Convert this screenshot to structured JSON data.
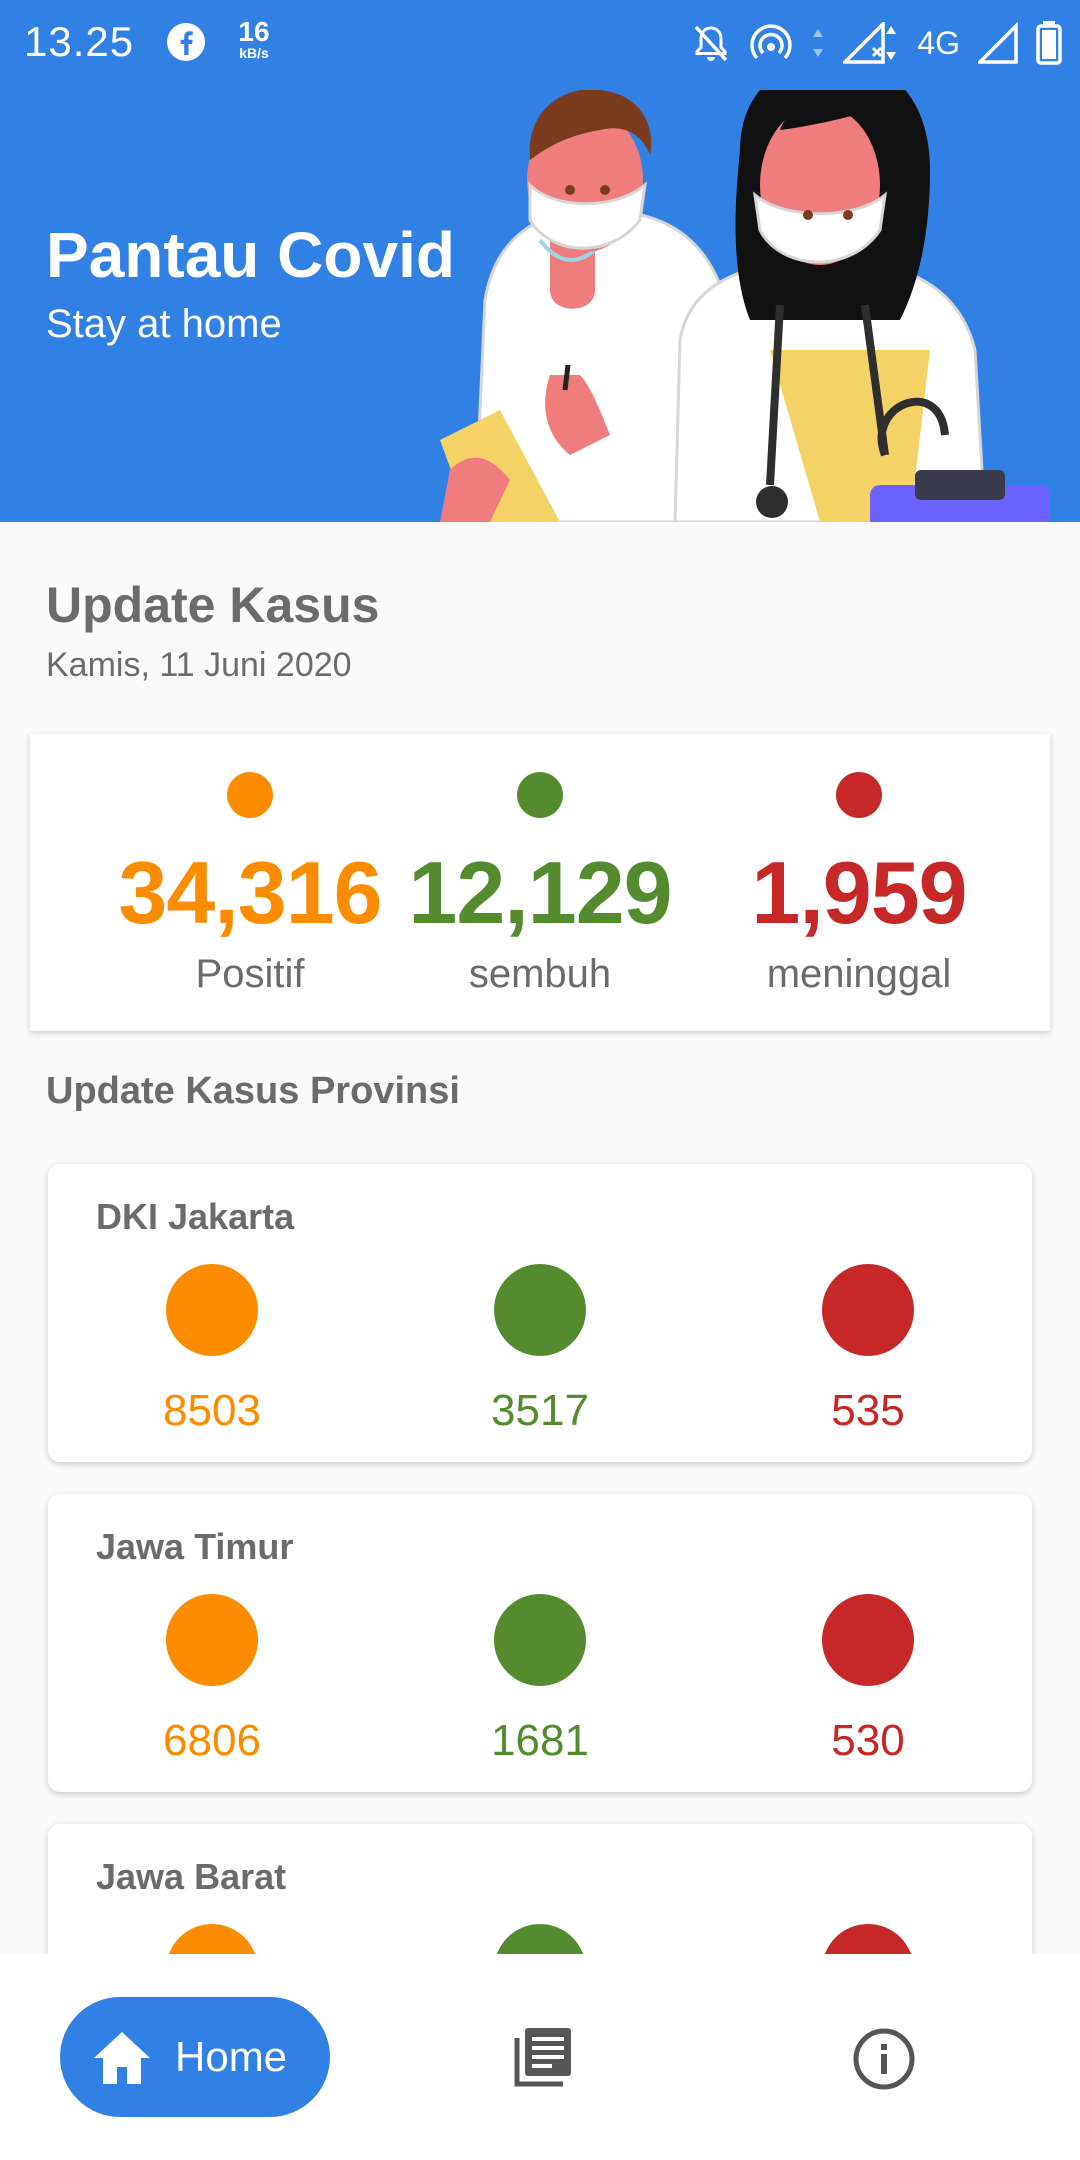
{
  "status_bar": {
    "time": "13.25",
    "speed_value": "16",
    "speed_unit": "kB/s",
    "network": "4G"
  },
  "header": {
    "title": "Pantau Covid",
    "subtitle": "Stay at home"
  },
  "update": {
    "title": "Update Kasus",
    "date": "Kamis, 11 Juni 2020",
    "stats": [
      {
        "value": "34,316",
        "label": "Positif",
        "color": "#fb8c00"
      },
      {
        "value": "12,129",
        "label": "sembuh",
        "color": "#558b2f"
      },
      {
        "value": "1,959",
        "label": "meninggal",
        "color": "#c62828"
      }
    ]
  },
  "provinces": {
    "title": "Update Kasus Provinsi",
    "items": [
      {
        "name": "DKI Jakarta",
        "positif": "8503",
        "sembuh": "3517",
        "meninggal": "535"
      },
      {
        "name": "Jawa Timur",
        "positif": "6806",
        "sembuh": "1681",
        "meninggal": "530"
      },
      {
        "name": "Jawa Barat",
        "positif": "",
        "sembuh": "",
        "meninggal": ""
      }
    ]
  },
  "bottom_nav": {
    "home_label": "Home"
  },
  "colors": {
    "primary": "#3181e5",
    "positif": "#fb8c00",
    "sembuh": "#558b2f",
    "meninggal": "#c62828"
  },
  "icons": [
    "facebook-icon",
    "notifications-off-icon",
    "hotspot-icon",
    "signal-icon",
    "battery-icon",
    "home-icon",
    "news-icon",
    "info-icon"
  ]
}
